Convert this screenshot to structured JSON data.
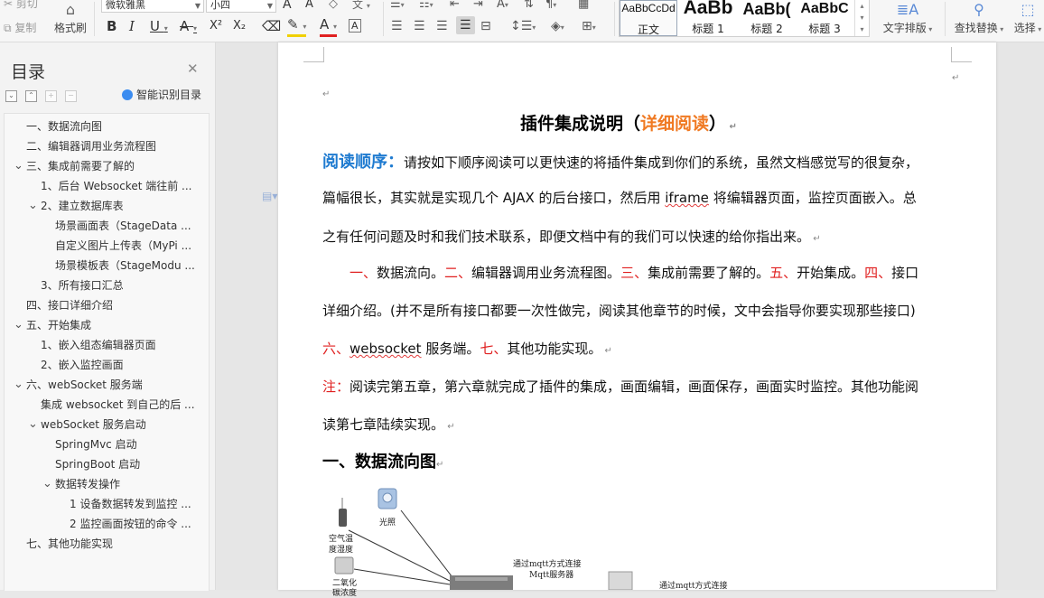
{
  "ribbon": {
    "cut": "剪切",
    "copy": "复制",
    "format_painter": "格式刷",
    "font_name": "微软雅黑",
    "font_size": "小四",
    "bold": "B",
    "italic": "I",
    "underline": "U",
    "strike": "A",
    "superscript": "X²",
    "subscript": "X₂",
    "font_color_a": "A",
    "char_border": "A",
    "grow_font": "A",
    "shrink_font": "A",
    "styles": [
      {
        "sample": "AaBbCcDd",
        "label": "正文"
      },
      {
        "sample": "AaBb",
        "label": "标题 1"
      },
      {
        "sample": "AaBb(",
        "label": "标题 2"
      },
      {
        "sample": "AaBbC",
        "label": "标题 3"
      }
    ],
    "text_layout": "文字排版",
    "find_replace": "查找替换",
    "select": "选择"
  },
  "toc": {
    "title": "目录",
    "ai_toc": "智能识别目录",
    "items": [
      {
        "text": "一、数据流向图",
        "level": 1,
        "arrow": ""
      },
      {
        "text": "二、编辑器调用业务流程图",
        "level": 1,
        "arrow": ""
      },
      {
        "text": "三、集成前需要了解的",
        "level": 1,
        "arrow": "v"
      },
      {
        "text": "1、后台 Websocket 端往前 ...",
        "level": 2,
        "arrow": ""
      },
      {
        "text": "2、建立数据库表",
        "level": 2,
        "arrow": "v"
      },
      {
        "text": "场景画面表（StageData ...",
        "level": 3,
        "arrow": ""
      },
      {
        "text": "自定义图片上传表（MyPi ...",
        "level": 3,
        "arrow": ""
      },
      {
        "text": "场景模板表（StageModu ...",
        "level": 3,
        "arrow": ""
      },
      {
        "text": "3、所有接口汇总",
        "level": 2,
        "arrow": ""
      },
      {
        "text": "四、接口详细介绍",
        "level": 1,
        "arrow": ""
      },
      {
        "text": "五、开始集成",
        "level": 1,
        "arrow": "v"
      },
      {
        "text": "1、嵌入组态编辑器页面",
        "level": 2,
        "arrow": ""
      },
      {
        "text": "2、嵌入监控画面",
        "level": 2,
        "arrow": ""
      },
      {
        "text": "六、webSocket 服务端",
        "level": 1,
        "arrow": "v"
      },
      {
        "text": "集成 websocket 到自己的后 ...",
        "level": 2,
        "arrow": ""
      },
      {
        "text": "webSocket 服务启动",
        "level": 2,
        "arrow": "v"
      },
      {
        "text": "SpringMvc 启动",
        "level": 3,
        "arrow": ""
      },
      {
        "text": "SpringBoot 启动",
        "level": 3,
        "arrow": ""
      },
      {
        "text": "数据转发操作",
        "level": 3,
        "arrow": "v"
      },
      {
        "text": "1 设备数据转发到监控 ...",
        "level": 4,
        "arrow": ""
      },
      {
        "text": "2 监控画面按钮的命令 ...",
        "level": 4,
        "arrow": ""
      },
      {
        "text": "七、其他功能实现",
        "level": 1,
        "arrow": ""
      }
    ]
  },
  "doc": {
    "title_main": "插件集成说明（",
    "title_highlight": "详细阅读",
    "title_end": "）",
    "read_order_label": "阅读顺序：",
    "p1_a": "请按如下顺序阅读可以更快速的将插件集成到你们的系统，虽然文档感觉写的很复杂，",
    "p1_b1": "篇幅很长，其实就是实现几个 AJAX 的后台接口，然后用 ",
    "p1_b_iframe": "iframe",
    "p1_b2": " 将编辑器页面，监控页面嵌入。总",
    "p1_c": "之有任何问题及时和我们技术联系，即便文档中有的我们可以快速的给你指出来。",
    "order": [
      {
        "n": "一、",
        "t": "数据流向。"
      },
      {
        "n": "二、",
        "t": "编辑器调用业务流程图。"
      },
      {
        "n": "三、",
        "t": "集成前需要了解的。"
      },
      {
        "n": "五、",
        "t": "开始集成。"
      },
      {
        "n": "四、",
        "t": "接口"
      }
    ],
    "p2_b": "详细介绍。(并不是所有接口都要一次性做完，阅读其他章节的时候，文中会指导你要实现那些接口)",
    "p2_c_n1": "六、",
    "p2_c_ws": "websocket",
    "p2_c_t1": " 服务端。",
    "p2_c_n2": "七、",
    "p2_c_t2": "其他功能实现。",
    "note_label": "注：",
    "note_a": "阅读完第五章，第六章就完成了插件的集成，画面编辑，画面保存，画面实时监控。其他功能阅",
    "note_b": "读第七章陆续实现。",
    "section1": "一、数据流向图"
  },
  "diagram": {
    "light": "光照",
    "air": "空气温",
    "humidity": "度湿度",
    "co2_a": "二氧化",
    "co2_b": "碳浓度",
    "mqtt_a": "通过mqtt方式连接",
    "mqtt_b": "Mqtt服务器",
    "mqtt_c": "通过mqtt方式连接"
  }
}
